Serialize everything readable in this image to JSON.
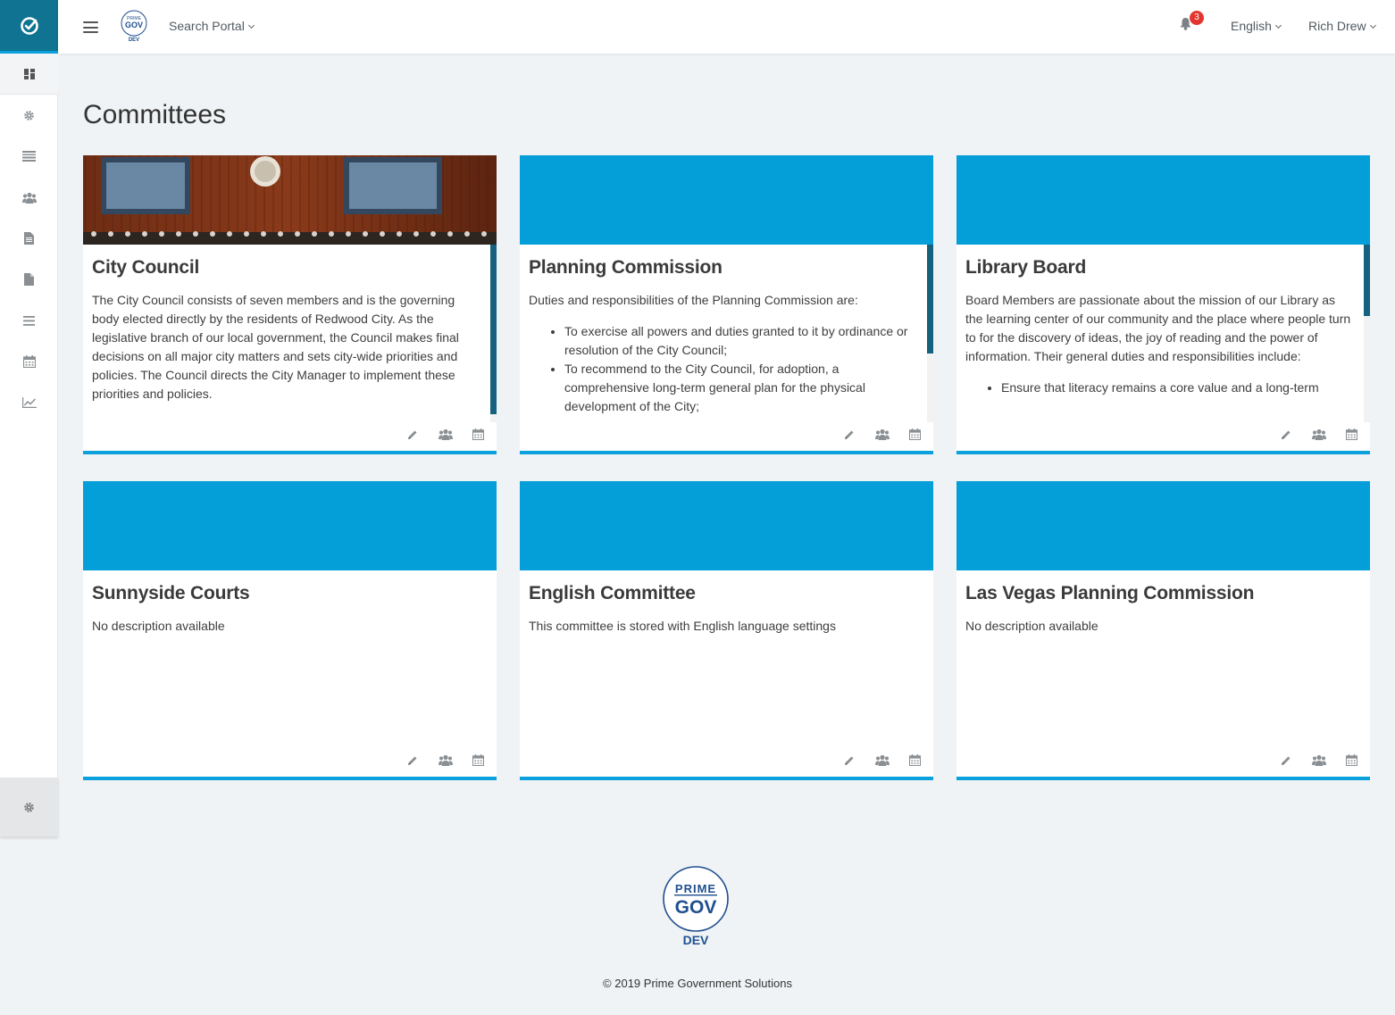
{
  "header": {
    "search_portal": "Search Portal",
    "notifications_count": "3",
    "language": "English",
    "user_name": "Rich Drew",
    "brand_top": "PRIME",
    "brand_mid": "GOV",
    "brand_env": "DEV"
  },
  "page": {
    "title": "Committees"
  },
  "committees": [
    {
      "title": "City Council",
      "description": "The City Council consists of seven members and is the governing body elected directly by the residents of Redwood City. As the legislative branch of our local government, the Council makes final decisions on all major city matters and sets city-wide priorities and policies. The Council directs the City Manager to implement these priorities and policies.",
      "bullets": []
    },
    {
      "title": "Planning Commission",
      "description": "Duties and responsibilities of the Planning Commission are:",
      "bullets": [
        "To exercise all powers and duties granted to it by ordinance or resolution of the City Council;",
        "To recommend to the City Council, for adoption, a comprehensive long-term general plan for the physical development of the City;"
      ]
    },
    {
      "title": "Library Board",
      "description": "Board Members are passionate about the mission of our Library as the learning center of our community and the place where people turn to for the discovery of ideas, the joy of reading and the power of information. Their general duties and responsibilities include:",
      "bullets": [
        "Ensure that literacy remains a core value and a long-term"
      ]
    },
    {
      "title": "Sunnyside Courts",
      "description": "No description available",
      "bullets": []
    },
    {
      "title": "English Committee",
      "description": "This committee is stored with English language settings",
      "bullets": []
    },
    {
      "title": "Las Vegas Planning Commission",
      "description": "No description available",
      "bullets": []
    }
  ],
  "footer": {
    "brand_top": "PRIME",
    "brand_mid": "GOV",
    "brand_env": "DEV",
    "copyright": "© 2019 Prime Government Solutions"
  },
  "colors": {
    "accent": "#0aa1dc",
    "banner": "#049ed8",
    "rail_logo": "#0f7391",
    "badge": "#e3342f"
  },
  "icons": [
    "check-circle-icon",
    "dashboard-icon",
    "gear-icon",
    "list-icon",
    "users-icon",
    "document-icon",
    "file-icon",
    "menu-list-icon",
    "calendar-icon",
    "chart-icon",
    "pencil-icon",
    "bell-icon"
  ]
}
